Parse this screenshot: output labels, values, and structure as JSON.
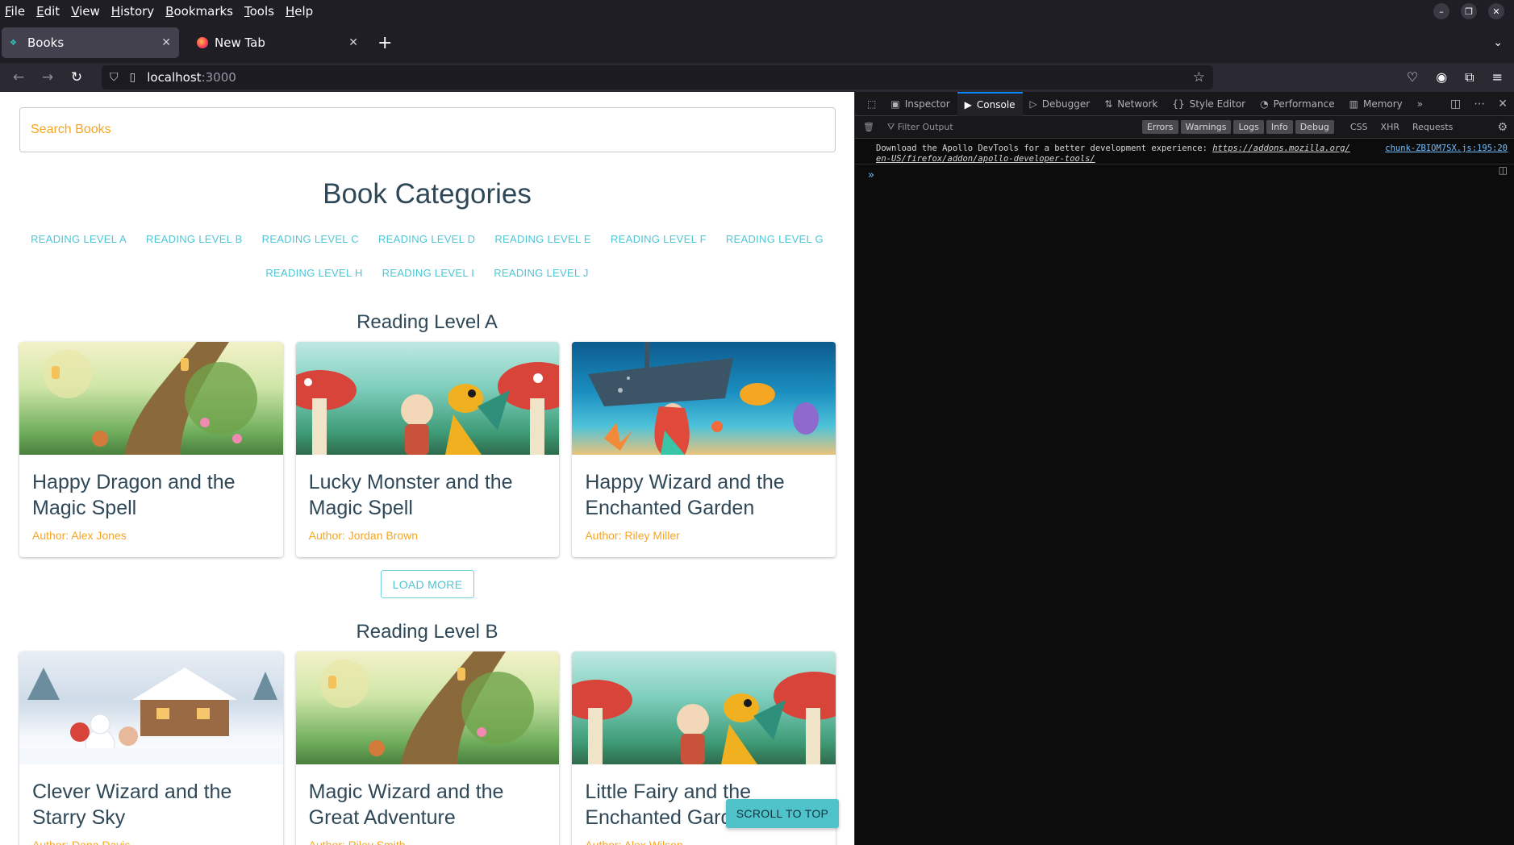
{
  "browser": {
    "menu": [
      "File",
      "Edit",
      "View",
      "History",
      "Bookmarks",
      "Tools",
      "Help"
    ],
    "tabs": [
      {
        "label": "Books",
        "favicon": "books-app-icon",
        "active": true
      },
      {
        "label": "New Tab",
        "favicon": "firefox-icon",
        "active": false
      }
    ],
    "url_host": "localhost",
    "url_port": ":3000"
  },
  "page": {
    "search_placeholder": "Search Books",
    "title": "Book Categories",
    "categories_row1": [
      "READING LEVEL A",
      "READING LEVEL B",
      "READING LEVEL C",
      "READING LEVEL D",
      "READING LEVEL E",
      "READING LEVEL F",
      "READING LEVEL G"
    ],
    "categories_row2": [
      "READING LEVEL H",
      "READING LEVEL I",
      "READING LEVEL J"
    ],
    "sections": [
      {
        "title": "Reading Level A",
        "books": [
          {
            "title": "Happy Dragon and the Magic Spell",
            "author": "Author: Alex Jones",
            "image": "fairy-forest-illustration"
          },
          {
            "title": "Lucky Monster and the Magic Spell",
            "author": "Author: Jordan Brown",
            "image": "dragon-mushroom-illustration"
          },
          {
            "title": "Happy Wizard and the Enchanted Garden",
            "author": "Author: Riley Miller",
            "image": "mermaid-undersea-illustration"
          }
        ]
      },
      {
        "title": "Reading Level B",
        "books": [
          {
            "title": "Clever Wizard and the Starry Sky",
            "author": "Author: Dana Davis",
            "image": "snow-cottage-illustration"
          },
          {
            "title": "Magic Wizard and the Great Adventure",
            "author": "Author: Riley Smith",
            "image": "fairy-forest-illustration"
          },
          {
            "title": "Little Fairy and the Enchanted Garden",
            "author": "Author: Alex Wilson",
            "image": "dragon-mushroom-illustration"
          }
        ]
      }
    ],
    "load_more": "LOAD MORE",
    "scroll_to_top": "SCROLL TO TOP"
  },
  "devtools": {
    "tabs": [
      "Inspector",
      "Console",
      "Debugger",
      "Network",
      "Style Editor",
      "Performance",
      "Memory"
    ],
    "active_tab": "Console",
    "filter_placeholder": "Filter Output",
    "levels": [
      "Errors",
      "Warnings",
      "Logs",
      "Info",
      "Debug"
    ],
    "net_filters": [
      "CSS",
      "XHR",
      "Requests"
    ],
    "message_text": "Download the Apollo DevTools for a better development experience: ",
    "message_link1": "https://addons.mozilla.org/",
    "message_link2": "en-US/firefox/addon/apollo-developer-tools/",
    "message_source": "chunk-ZBIOM7SX.js:195:20",
    "prompt": "»"
  },
  "colors": {
    "accent_teal": "#4cc6d6",
    "author_orange": "#f5a623",
    "heading": "#2f4858"
  }
}
